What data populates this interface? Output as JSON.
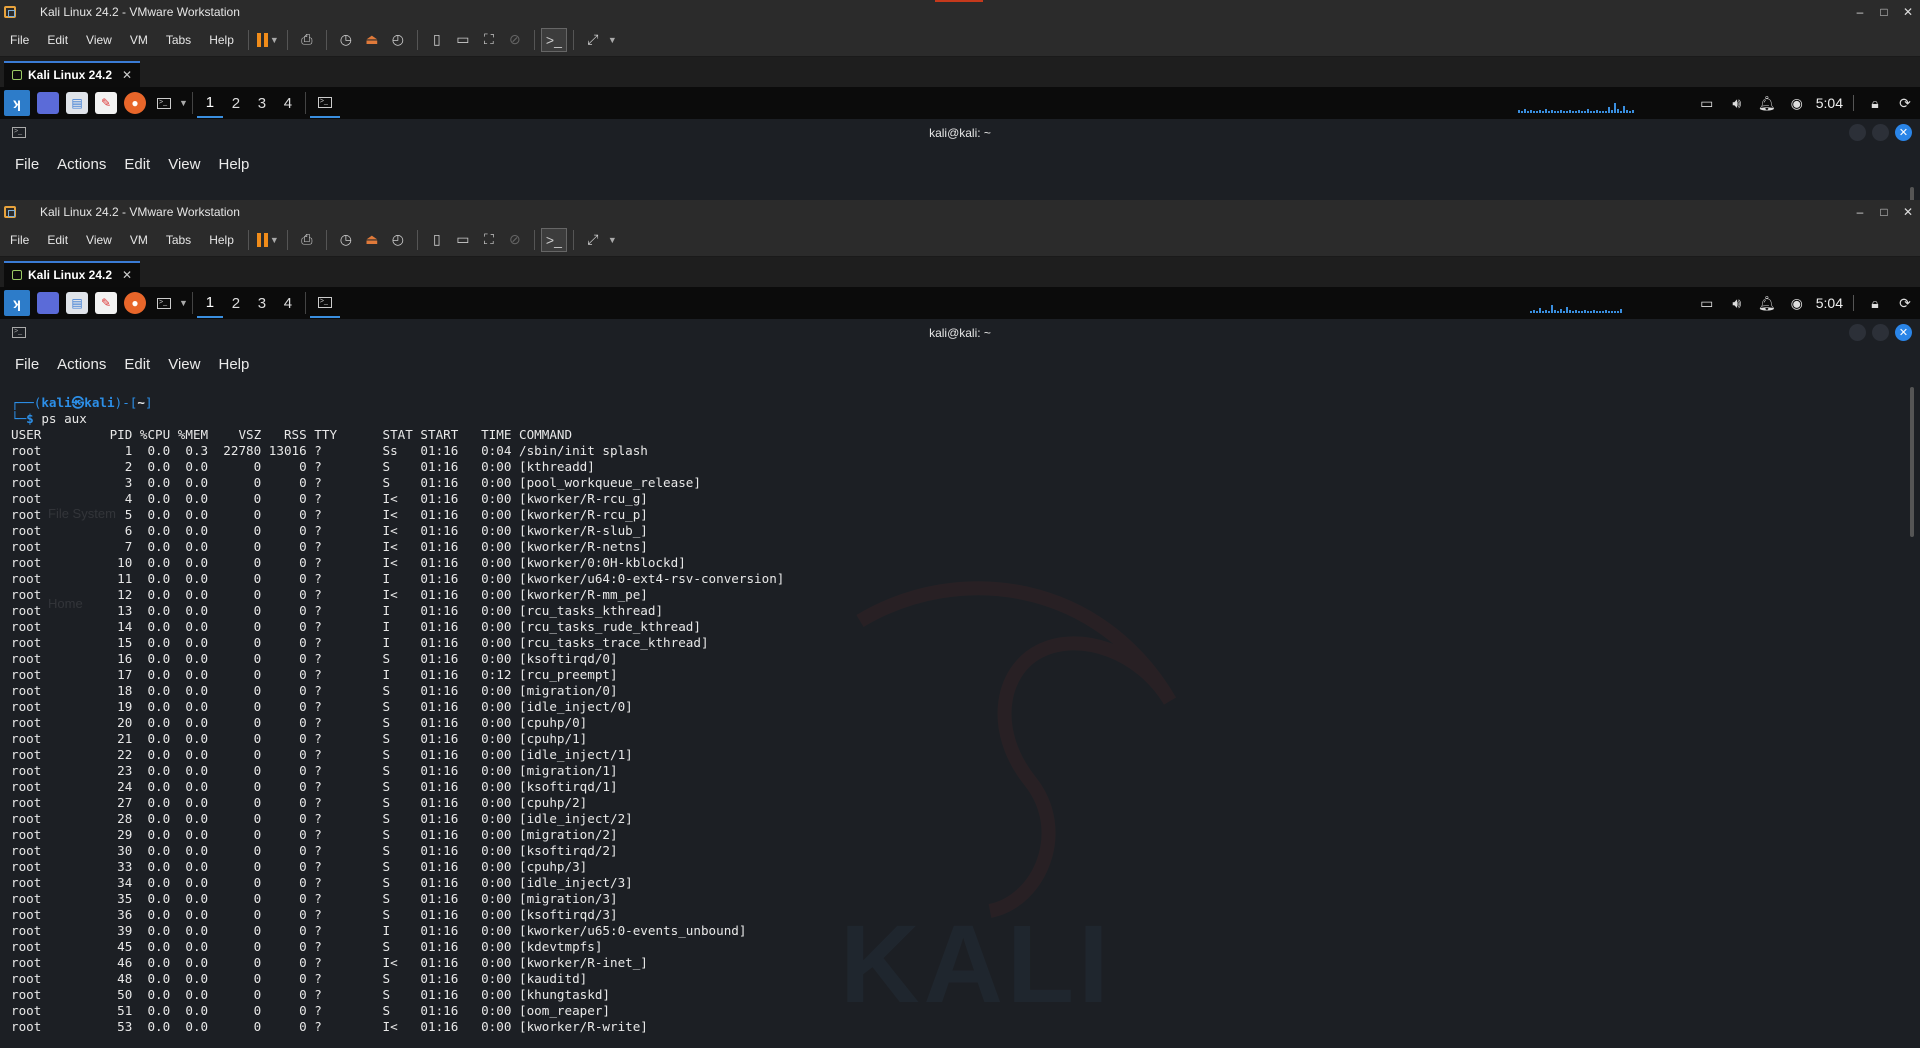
{
  "window": {
    "title": "Kali Linux 24.2 - VMware Workstation",
    "controls": [
      "–",
      "□",
      "✕"
    ]
  },
  "vmware_menu": [
    "File",
    "Edit",
    "View",
    "VM",
    "Tabs",
    "Help"
  ],
  "vm_tab": {
    "label": "Kali Linux 24.2",
    "close": "✕"
  },
  "panel": {
    "workspaces": [
      "1",
      "2",
      "3",
      "4"
    ],
    "clock": "5:04"
  },
  "terminal": {
    "title": "kali@kali: ~",
    "menu": [
      "File",
      "Actions",
      "Edit",
      "View",
      "Help"
    ],
    "prompt_line1_prefix": "┌──(",
    "prompt_user": "kali㉿kali",
    "prompt_line1_mid": ")-[",
    "prompt_dir": "~",
    "prompt_line1_suffix": "]",
    "prompt_line2_prefix": "└─",
    "prompt_symbol": "$ ",
    "command": "ps aux",
    "header": "USER         PID %CPU %MEM    VSZ   RSS TTY      STAT START   TIME COMMAND",
    "rows": [
      "root           1  0.0  0.3  22780 13016 ?        Ss   01:16   0:04 /sbin/init splash",
      "root           2  0.0  0.0      0     0 ?        S    01:16   0:00 [kthreadd]",
      "root           3  0.0  0.0      0     0 ?        S    01:16   0:00 [pool_workqueue_release]",
      "root           4  0.0  0.0      0     0 ?        I<   01:16   0:00 [kworker/R-rcu_g]",
      "root           5  0.0  0.0      0     0 ?        I<   01:16   0:00 [kworker/R-rcu_p]",
      "root           6  0.0  0.0      0     0 ?        I<   01:16   0:00 [kworker/R-slub_]",
      "root           7  0.0  0.0      0     0 ?        I<   01:16   0:00 [kworker/R-netns]",
      "root          10  0.0  0.0      0     0 ?        I<   01:16   0:00 [kworker/0:0H-kblockd]",
      "root          11  0.0  0.0      0     0 ?        I    01:16   0:00 [kworker/u64:0-ext4-rsv-conversion]",
      "root          12  0.0  0.0      0     0 ?        I<   01:16   0:00 [kworker/R-mm_pe]",
      "root          13  0.0  0.0      0     0 ?        I    01:16   0:00 [rcu_tasks_kthread]",
      "root          14  0.0  0.0      0     0 ?        I    01:16   0:00 [rcu_tasks_rude_kthread]",
      "root          15  0.0  0.0      0     0 ?        I    01:16   0:00 [rcu_tasks_trace_kthread]",
      "root          16  0.0  0.0      0     0 ?        S    01:16   0:00 [ksoftirqd/0]",
      "root          17  0.0  0.0      0     0 ?        I    01:16   0:12 [rcu_preempt]",
      "root          18  0.0  0.0      0     0 ?        S    01:16   0:00 [migration/0]",
      "root          19  0.0  0.0      0     0 ?        S    01:16   0:00 [idle_inject/0]",
      "root          20  0.0  0.0      0     0 ?        S    01:16   0:00 [cpuhp/0]",
      "root          21  0.0  0.0      0     0 ?        S    01:16   0:00 [cpuhp/1]",
      "root          22  0.0  0.0      0     0 ?        S    01:16   0:00 [idle_inject/1]",
      "root          23  0.0  0.0      0     0 ?        S    01:16   0:00 [migration/1]",
      "root          24  0.0  0.0      0     0 ?        S    01:16   0:00 [ksoftirqd/1]",
      "root          27  0.0  0.0      0     0 ?        S    01:16   0:00 [cpuhp/2]",
      "root          28  0.0  0.0      0     0 ?        S    01:16   0:00 [idle_inject/2]",
      "root          29  0.0  0.0      0     0 ?        S    01:16   0:00 [migration/2]",
      "root          30  0.0  0.0      0     0 ?        S    01:16   0:00 [ksoftirqd/2]",
      "root          33  0.0  0.0      0     0 ?        S    01:16   0:00 [cpuhp/3]",
      "root          34  0.0  0.0      0     0 ?        S    01:16   0:00 [idle_inject/3]",
      "root          35  0.0  0.0      0     0 ?        S    01:16   0:00 [migration/3]",
      "root          36  0.0  0.0      0     0 ?        S    01:16   0:00 [ksoftirqd/3]",
      "root          39  0.0  0.0      0     0 ?        I    01:16   0:00 [kworker/u65:0-events_unbound]",
      "root          45  0.0  0.0      0     0 ?        S    01:16   0:00 [kdevtmpfs]",
      "root          46  0.0  0.0      0     0 ?        I<   01:16   0:00 [kworker/R-inet_]",
      "root          48  0.0  0.0      0     0 ?        S    01:16   0:00 [kauditd]",
      "root          50  0.0  0.0      0     0 ?        S    01:16   0:00 [khungtaskd]",
      "root          51  0.0  0.0      0     0 ?        S    01:16   0:00 [oom_reaper]",
      "root          53  0.0  0.0      0     0 ?        I<   01:16   0:00 [kworker/R-write]"
    ]
  },
  "desktop_ghost": {
    "filesystem": "File System",
    "home": "Home"
  },
  "watermark": "KALI",
  "colors": {
    "accent": "#2c8fe8",
    "vmware_pause": "#f08c1a",
    "terminal_bg": "#1c1f24"
  }
}
